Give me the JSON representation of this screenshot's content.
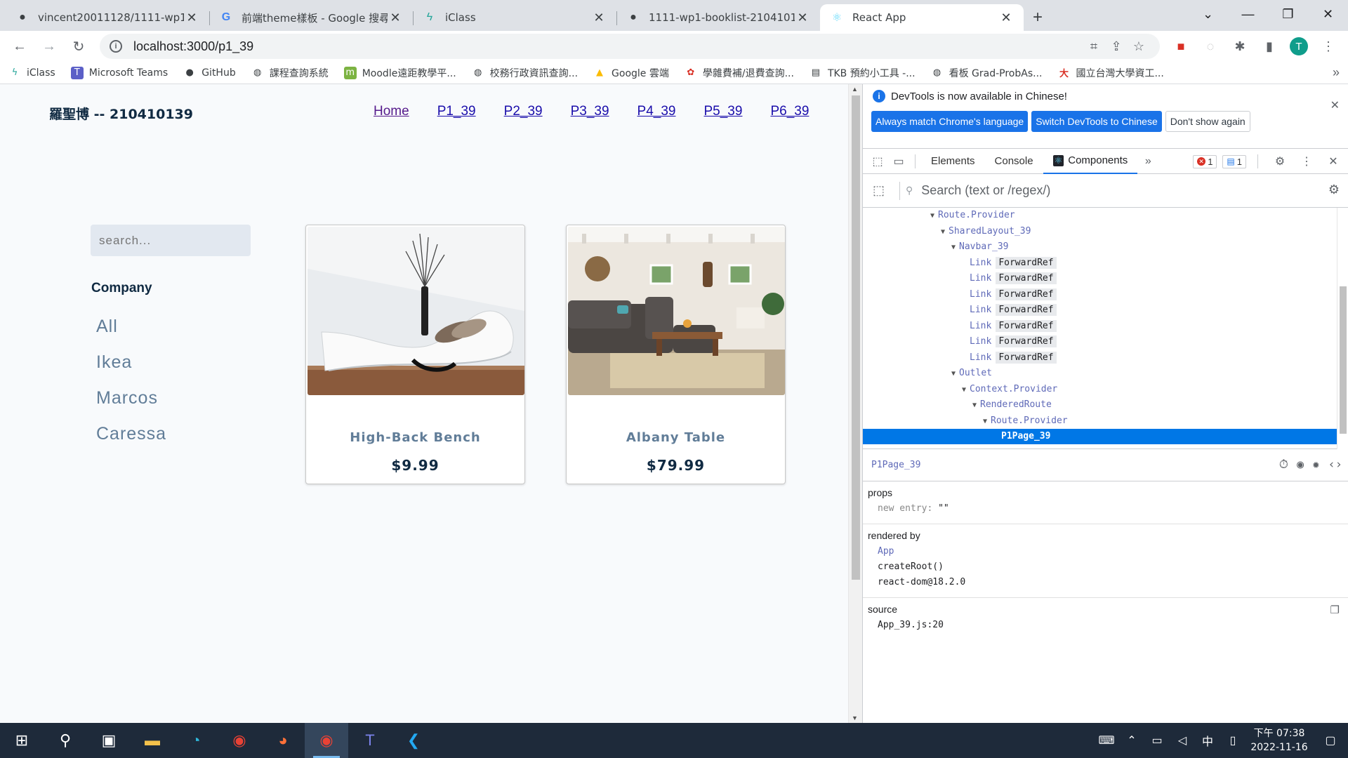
{
  "browser": {
    "tabs": [
      {
        "title": "vincent20011128/1111-wp1-b",
        "icon": "github-icon"
      },
      {
        "title": "前端theme樣板 - Google 搜尋",
        "icon": "google-icon"
      },
      {
        "title": "iClass",
        "icon": "iclass-icon"
      },
      {
        "title": "1111-wp1-booklist-21041013",
        "icon": "github-icon"
      },
      {
        "title": "React App",
        "icon": "react-icon"
      }
    ],
    "url": "localhost:3000/p1_39",
    "profile_initial": "T",
    "bookmarks": [
      {
        "label": "iClass",
        "icon": "iclass-icon"
      },
      {
        "label": "Microsoft Teams",
        "icon": "teams-icon"
      },
      {
        "label": "GitHub",
        "icon": "github-icon"
      },
      {
        "label": "課程查詢系統",
        "icon": "globe-icon"
      },
      {
        "label": "Moodle遠距教學平...",
        "icon": "moodle-icon"
      },
      {
        "label": "校務行政資訊查詢...",
        "icon": "globe-icon"
      },
      {
        "label": "Google 雲端",
        "icon": "drive-icon"
      },
      {
        "label": "學雜費補/退費查詢...",
        "icon": "school-icon"
      },
      {
        "label": "TKB 預約小工具 -...",
        "icon": "doc-icon"
      },
      {
        "label": "看板 Grad-ProbAs...",
        "icon": "globe-icon"
      },
      {
        "label": "國立台灣大學資工...",
        "icon": "ntu-icon"
      }
    ]
  },
  "app": {
    "brand": "羅聖博 -- 210410139",
    "nav": [
      "Home",
      "P1_39",
      "P2_39",
      "P3_39",
      "P4_39",
      "P5_39",
      "P6_39"
    ],
    "search_placeholder": "search...",
    "company_heading": "Company",
    "categories": [
      "All",
      "Ikea",
      "Marcos",
      "Caressa"
    ],
    "products": [
      {
        "name": "High-Back Bench",
        "price": "$9.99"
      },
      {
        "name": "Albany Table",
        "price": "$79.99"
      }
    ]
  },
  "devtools": {
    "banner": "DevTools is now available in Chinese!",
    "banner_buttons": [
      "Always match Chrome's language",
      "Switch DevTools to Chinese",
      "Don't show again"
    ],
    "tabs": [
      "Elements",
      "Console",
      "Components"
    ],
    "active_tab": "Components",
    "error_count": "1",
    "message_count": "1",
    "search_placeholder": "Search (text or /regex/)",
    "tree": [
      {
        "label": "Route.Provider",
        "depth": 0,
        "arrow": true
      },
      {
        "label": "SharedLayout_39",
        "depth": 1,
        "arrow": true
      },
      {
        "label": "Navbar_39",
        "depth": 2,
        "arrow": true
      },
      {
        "label": "Link",
        "chip": "ForwardRef",
        "depth": 3
      },
      {
        "label": "Link",
        "chip": "ForwardRef",
        "depth": 3
      },
      {
        "label": "Link",
        "chip": "ForwardRef",
        "depth": 3
      },
      {
        "label": "Link",
        "chip": "ForwardRef",
        "depth": 3
      },
      {
        "label": "Link",
        "chip": "ForwardRef",
        "depth": 3
      },
      {
        "label": "Link",
        "chip": "ForwardRef",
        "depth": 3
      },
      {
        "label": "Link",
        "chip": "ForwardRef",
        "depth": 3
      },
      {
        "label": "Outlet",
        "depth": 2,
        "arrow": true
      },
      {
        "label": "Context.Provider",
        "depth": 3,
        "arrow": true
      },
      {
        "label": "RenderedRoute",
        "depth": 4,
        "arrow": true
      },
      {
        "label": "Route.Provider",
        "depth": 5,
        "arrow": true
      },
      {
        "label": "P1Page_39",
        "depth": 6,
        "selected": true
      }
    ],
    "selected_component": "P1Page_39",
    "props_heading": "props",
    "props": [
      {
        "key": "new entry",
        "value": "\"\""
      }
    ],
    "rendered_by_heading": "rendered by",
    "rendered_by": [
      "App",
      "createRoot()",
      "react-dom@18.2.0"
    ],
    "source_heading": "source",
    "source": "App_39.js:20"
  },
  "taskbar": {
    "time_prefix": "下午 07:38",
    "date": "2022-11-16",
    "ime": "中"
  },
  "colors": {
    "selected_row": "#0077e6",
    "accent_blue": "#1a73e8",
    "page_bg": "#f8fafc"
  }
}
